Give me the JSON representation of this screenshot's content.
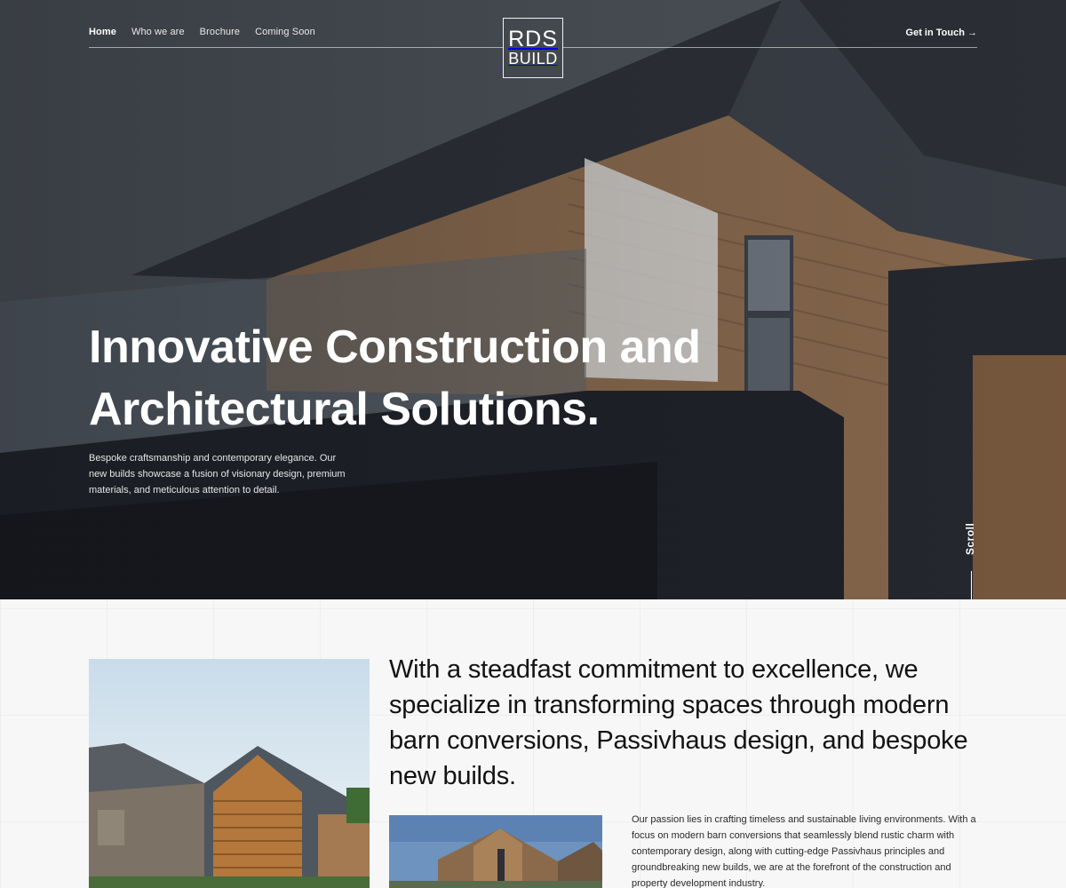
{
  "nav": {
    "items": [
      {
        "label": "Home",
        "active": true
      },
      {
        "label": "Who we are",
        "active": false
      },
      {
        "label": "Brochure",
        "active": false
      },
      {
        "label": "Coming Soon",
        "active": false
      }
    ],
    "cta_label": "Get in Touch →"
  },
  "logo": {
    "line1": "RDS",
    "line2": "BUILD"
  },
  "hero": {
    "title": "Innovative Construction and Architectural Solutions.",
    "subtitle": "Bespoke craftsmanship and contemporary elegance. Our new builds showcase a fusion of visionary design, premium materials, and meticulous attention to detail.",
    "scroll_label": "Scroll"
  },
  "about": {
    "heading": "With a steadfast commitment to excellence, we specialize in transforming spaces through modern barn conversions, Passivhaus design, and bespoke new builds.",
    "text": "Our passion lies in crafting timeless and sustainable living environments. With a focus on modern barn conversions that seamlessly blend rustic charm with contemporary design, along with cutting-edge Passivhaus principles and groundbreaking new builds, we are at the forefront of the construction and property development industry."
  },
  "colors": {
    "accent": "#ffffff",
    "text_dark": "#121212",
    "background_light": "#f7f7f8",
    "wood": "#a07a52"
  }
}
